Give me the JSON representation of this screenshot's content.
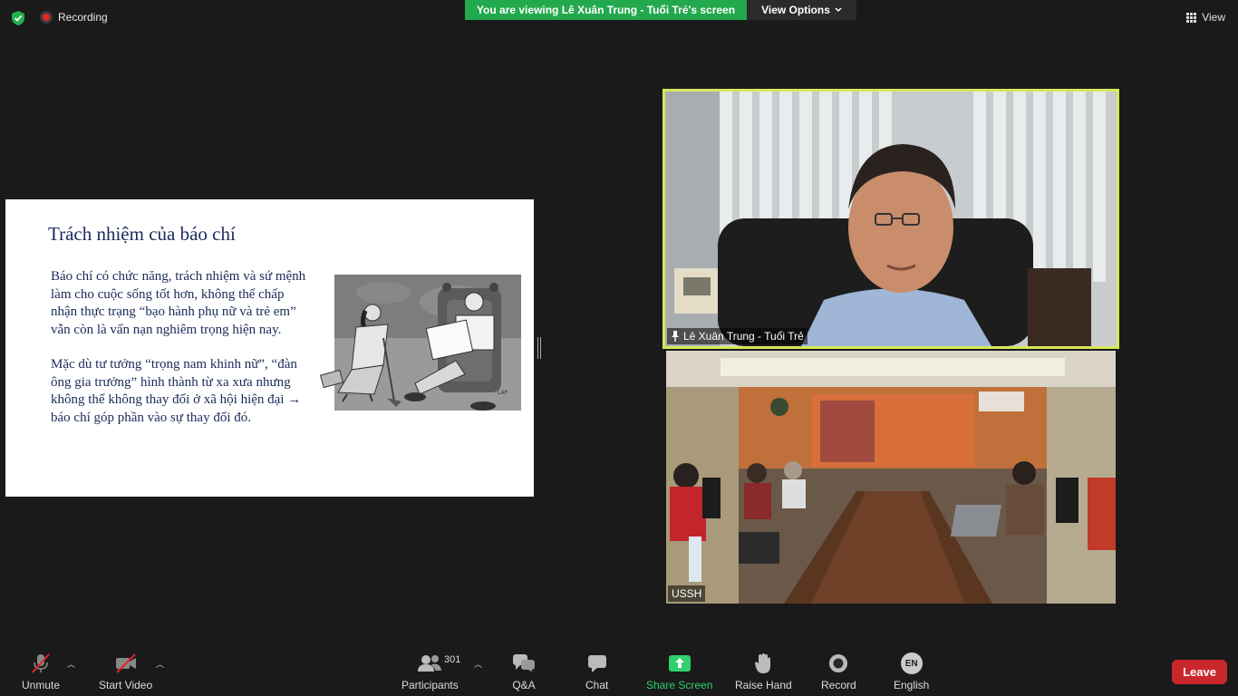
{
  "top": {
    "recording_label": "Recording",
    "viewing_banner": "You are viewing Lê Xuân Trung - Tuổi Trẻ's screen",
    "view_options_label": "View Options",
    "view_label": "View",
    "banner_color": "#23a94d"
  },
  "slide": {
    "title": "Trách nhiệm của báo chí",
    "paragraph1": "Báo chí có chức năng, trách nhiệm và sứ mệnh làm cho cuộc sống tốt hơn, không thể chấp nhận thực trạng “bạo hành phụ nữ và trẻ em” vẫn còn là vấn nạn nghiêm trọng hiện nay.",
    "paragraph2": "Mặc dù tư tưởng “trọng nam khinh nữ”, “đàn ông gia trưởng” hình thành từ xa xưa nhưng không thể không thay đổi ở xã hội hiện đại → báo chí góp phần vào sự thay đổi đó."
  },
  "videos": {
    "speaker_name": "Lê Xuân Trung - Tuổi Trẻ",
    "room_name": "USSH",
    "active_speaker_border": "#d7e85a"
  },
  "toolbar": {
    "unmute": "Unmute",
    "start_video": "Start Video",
    "participants": "Participants",
    "participants_count": "301",
    "qa": "Q&A",
    "chat": "Chat",
    "share_screen": "Share Screen",
    "raise_hand": "Raise Hand",
    "record": "Record",
    "language_code": "EN",
    "language": "English",
    "leave": "Leave",
    "share_color": "#2fd06b",
    "leave_color": "#c9272c"
  }
}
